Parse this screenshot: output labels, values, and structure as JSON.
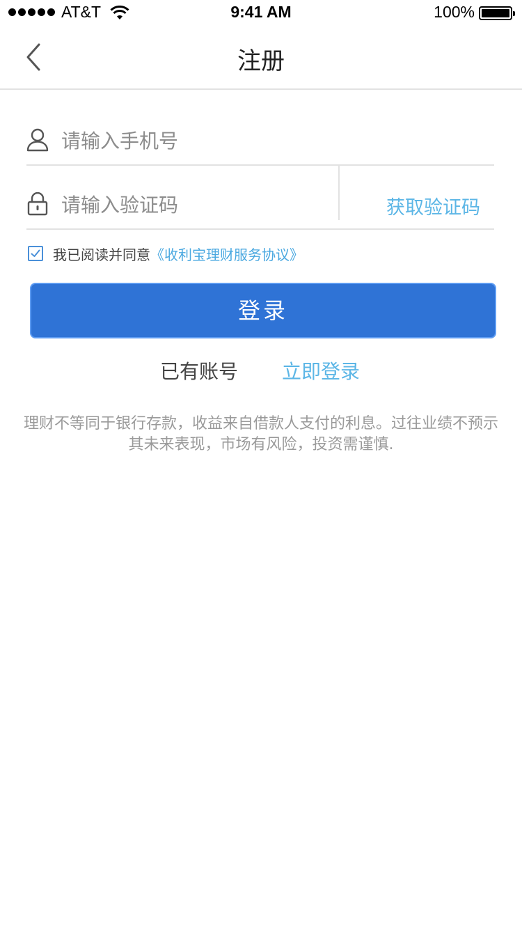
{
  "status_bar": {
    "carrier": "AT&T",
    "time": "9:41 AM",
    "battery_percent": "100%",
    "battery_level": 1.0
  },
  "nav": {
    "title": "注册",
    "back_icon": "chevron-left-icon"
  },
  "form": {
    "phone": {
      "icon": "user-icon",
      "placeholder": "请输入手机号",
      "value": ""
    },
    "code": {
      "icon": "lock-icon",
      "placeholder": "请输入验证码",
      "value": "",
      "get_code_label": "获取验证码"
    }
  },
  "agreement": {
    "checked": true,
    "text": "我已阅读并同意",
    "link": "《收利宝理财服务协议》"
  },
  "login_button": {
    "label": "登录"
  },
  "account": {
    "have_account": "已有账号",
    "login_now": "立即登录"
  },
  "disclaimer": "理财不等同于银行存款，收益来自借款人支付的利息。过往业绩不预示其未来表现，市场有风险，投资需谨慎.",
  "colors": {
    "primary": "#2f73d6",
    "link": "#5cb6e6",
    "divider": "#e2e2e2"
  }
}
